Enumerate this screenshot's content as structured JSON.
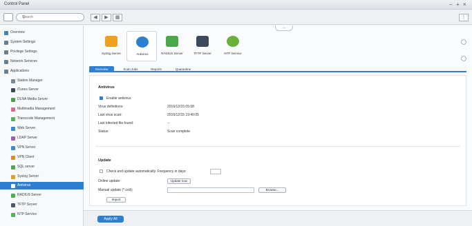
{
  "window": {
    "title": "Control Panel",
    "controls": [
      "–",
      "+",
      "×"
    ]
  },
  "toolbar": {
    "search_placeholder": "Search"
  },
  "sidebar": {
    "items": [
      {
        "label": "Overview",
        "icon": "overview-icon",
        "color": "#4a7fc1"
      },
      {
        "label": "System Settings",
        "icon": "gear-icon",
        "color": "#6b7f92"
      },
      {
        "label": "Privilege Settings",
        "icon": "user-icon",
        "color": "#6b7f92"
      },
      {
        "label": "Network Services",
        "icon": "network-icon",
        "color": "#6b7f92"
      },
      {
        "label": "Applications",
        "icon": "applications-icon",
        "color": "#6b7f92"
      },
      {
        "label": "Station Manager",
        "icon": "station-icon",
        "color": "#7a8a99"
      },
      {
        "label": "iTunes Server",
        "icon": "itunes-icon",
        "color": "#3a4a5a"
      },
      {
        "label": "DLNA Media Server",
        "icon": "dlna-icon",
        "color": "#4aa04a"
      },
      {
        "label": "Multimedia Management",
        "icon": "multimedia-icon",
        "color": "#d96a8a"
      },
      {
        "label": "Transcode Management",
        "icon": "transcode-icon",
        "color": "#58b058"
      },
      {
        "label": "Web Server",
        "icon": "web-icon",
        "color": "#3a8ad0"
      },
      {
        "label": "LDAP Server",
        "icon": "ldap-icon",
        "color": "#a05ab0"
      },
      {
        "label": "VPN Server",
        "icon": "vpn-server-icon",
        "color": "#3a8ad0"
      },
      {
        "label": "VPN Client",
        "icon": "vpn-client-icon",
        "color": "#e08a2a"
      },
      {
        "label": "SQL server",
        "icon": "sql-icon",
        "color": "#58a058"
      },
      {
        "label": "Syslog Server",
        "icon": "syslog-icon",
        "color": "#e0a020"
      },
      {
        "label": "Antivirus",
        "icon": "antivirus-icon",
        "color": "#c07030",
        "active": true
      },
      {
        "label": "RADIUS Server",
        "icon": "radius-icon",
        "color": "#4ab04a"
      },
      {
        "label": "TFTP Server",
        "icon": "tftp-icon",
        "color": "#4a5a6a"
      },
      {
        "label": "NTP Service",
        "icon": "ntp-icon",
        "color": "#5ab05a"
      }
    ]
  },
  "apps": [
    {
      "label": "Syslog Server",
      "icon": "syslog-icon",
      "color": "#f0a020"
    },
    {
      "label": "Antivirus",
      "icon": "antivirus-icon",
      "color": "#2c7fd1",
      "selected": true
    },
    {
      "label": "RADIUS Server",
      "icon": "radius-icon",
      "color": "#4aa84a"
    },
    {
      "label": "TFTP Server",
      "icon": "tftp-icon",
      "color": "#3a4a5a"
    },
    {
      "label": "NTP Service",
      "icon": "ntp-icon",
      "color": "#6ab03a"
    }
  ],
  "tabs": [
    "Overview",
    "Scan Jobs",
    "Reports",
    "Quarantine"
  ],
  "antivirus": {
    "section_title": "Antivirus",
    "enable_label": "Enable antivirus",
    "rows": [
      {
        "label": "Virus definitions:",
        "value": "2016/12/15 05:08"
      },
      {
        "label": "Last virus scan:",
        "value": "2016/12/15 19:40:05"
      },
      {
        "label": "Last infected file found:",
        "value": "--"
      },
      {
        "label": "Status:",
        "value": "Scan complete"
      }
    ]
  },
  "update": {
    "section_title": "Update",
    "auto_label": "Check and update automatically. Frequency in days:",
    "online_label": "Online update:",
    "online_button": "Update now",
    "manual_label": "Manual update (*.cvd):",
    "browse_button": "Browse...",
    "import_button": "Import"
  },
  "footer": {
    "apply_label": "Apply All"
  }
}
